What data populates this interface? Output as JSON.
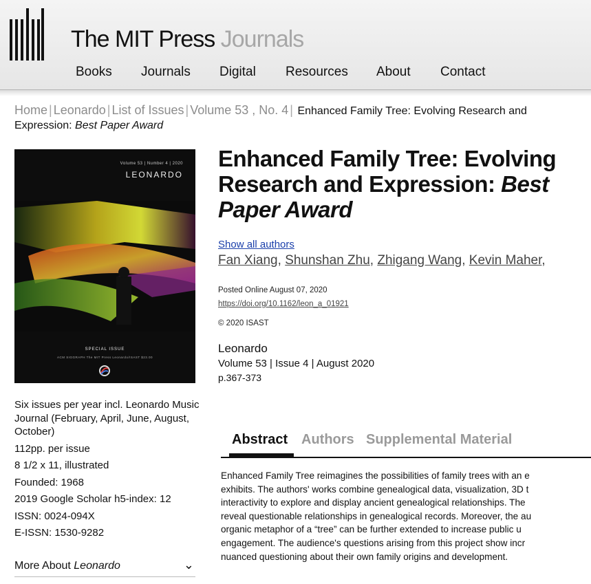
{
  "site": {
    "title_main": "The MIT Press",
    "title_sub": "Journals",
    "nav": [
      "Books",
      "Journals",
      "Digital",
      "Resources",
      "About",
      "Contact"
    ]
  },
  "breadcrumb": {
    "items": [
      "Home",
      "Leonardo",
      "List of Issues",
      "Volume 53 , No. 4"
    ],
    "current": "Enhanced Family Tree: Evolving Research and Expression:",
    "current_italic": "Best Paper Award"
  },
  "cover": {
    "volume_line": "Volume 53 | Number 4 | 2020",
    "journal": "LEONARDO",
    "special": "SPECIAL ISSUE",
    "footer": "ACM SIGGRAPH     The MIT Press     Leonardo/ISAST     $23.00"
  },
  "journal_info": {
    "lines": [
      "Six issues per year incl. Leonardo Music Journal (February, April, June, August, October)",
      "112pp. per issue",
      "8 1/2 x 11, illustrated",
      "Founded: 1968",
      "2019 Google Scholar h5-index: 12",
      "ISSN: 0024-094X",
      "E-ISSN: 1530-9282"
    ],
    "more_about_label": "More About",
    "more_about_italic": "Leonardo"
  },
  "article": {
    "title_line1": "Enhanced Family Tree: Evolving",
    "title_line2": "Research and Expression:",
    "title_italic_a": "Best",
    "title_italic_b": "Paper Award",
    "show_all_authors": "Show all authors",
    "authors": [
      "Fan Xiang",
      "Shunshan Zhu",
      "Zhigang Wang",
      "Kevin Maher"
    ],
    "posted": "Posted Online August 07, 2020",
    "doi": "https://doi.org/10.1162/leon_a_01921",
    "copyright": "© 2020 ISAST",
    "journal": "Leonardo",
    "volume_line": "Volume 53 | Issue 4 | August 2020",
    "pages": "p.367-373"
  },
  "tabs": [
    {
      "label": "Abstract",
      "active": true
    },
    {
      "label": "Authors",
      "active": false
    },
    {
      "label": "Supplemental Material",
      "active": false
    }
  ],
  "abstract_lines": [
    "Enhanced Family Tree reimagines the possibilities of family trees with an e",
    "exhibits. The authors' works combine genealogical data, visualization, 3D t",
    "interactivity to explore and display ancient genealogical relationships. The",
    "reveal questionable relationships in genealogical records. Moreover, the au",
    "organic metaphor of a “tree” can be further extended to increase public u",
    "engagement. The audience's questions arising from this project show incr",
    "nuanced questioning about their own family origins and development."
  ]
}
